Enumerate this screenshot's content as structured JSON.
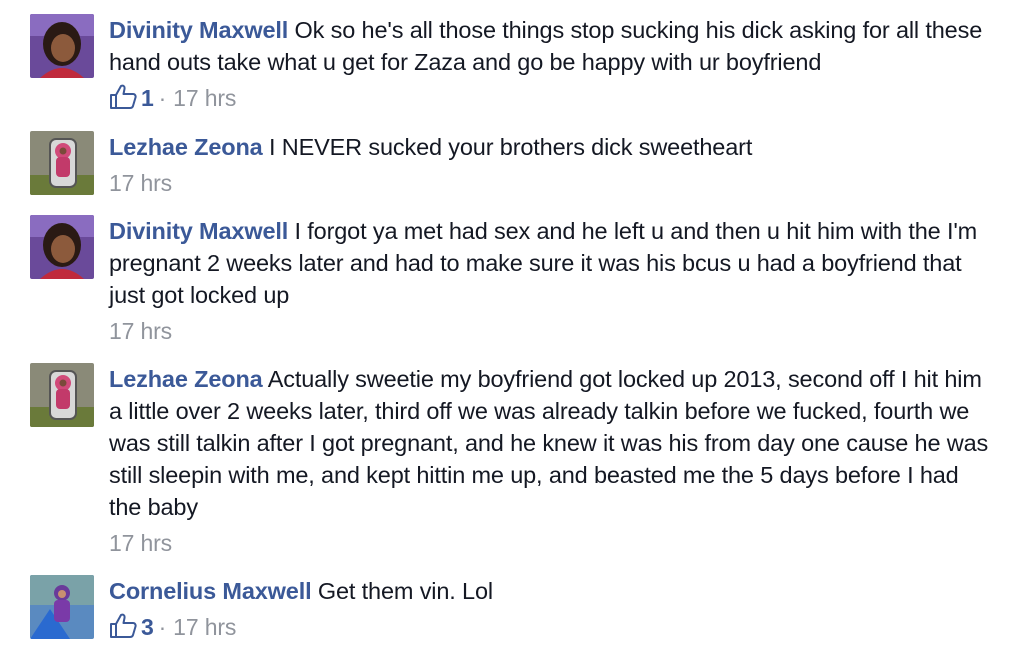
{
  "comments": [
    {
      "author": "Divinity Maxwell",
      "text": "Ok so he's all those things stop sucking his dick asking for all these hand outs take what u get for Zaza and go be happy with ur boyfriend",
      "likes": "1",
      "separator": "·",
      "time": "17 hrs",
      "avatar_icon": "profile-photo-woman"
    },
    {
      "author": "Lezhae Zeona",
      "text": "I NEVER sucked your brothers dick sweetheart",
      "likes": "",
      "separator": "",
      "time": "17 hrs",
      "avatar_icon": "profile-photo-child-in-stroller"
    },
    {
      "author": "Divinity Maxwell",
      "text": "I forgot ya met had sex and he left u and then u hit him with the I'm pregnant 2 weeks later and had to make sure it was his bcus u had a boyfriend that just got locked up",
      "likes": "",
      "separator": "",
      "time": "17 hrs",
      "avatar_icon": "profile-photo-woman"
    },
    {
      "author": "Lezhae Zeona",
      "text": "Actually sweetie my boyfriend got locked up 2013, second off I hit him a little over 2 weeks later, third off we was already talkin before we fucked, fourth we was still talkin after I got pregnant, and he knew it was his from day one cause he was still sleepin with me, and kept hittin me up, and beasted me the 5 days before I had the baby",
      "likes": "",
      "separator": "",
      "time": "17 hrs",
      "avatar_icon": "profile-photo-child-in-stroller"
    },
    {
      "author": "Cornelius Maxwell",
      "text": "Get them vin. Lol",
      "likes": "3",
      "separator": "·",
      "time": "17 hrs",
      "avatar_icon": "profile-photo-child-on-slide"
    }
  ],
  "colors": {
    "author": "#3b5998",
    "text": "#141823",
    "meta": "#90949c"
  }
}
